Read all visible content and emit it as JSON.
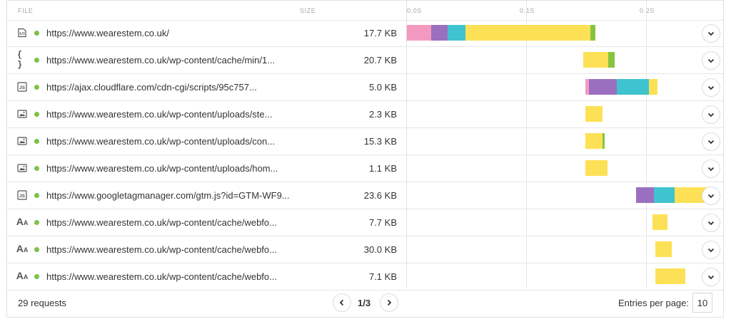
{
  "header": {
    "file_label": "FILE",
    "size_label": "SIZE",
    "ticks": [
      "0.0s",
      "0.1s",
      "0.2s"
    ]
  },
  "colors": {
    "blocking": "#f49ac1",
    "dns": "#9b6fc0",
    "connect": "#3fc3cf",
    "wait": "#fce156",
    "receive": "#86c440",
    "status_dot": "#7cc246"
  },
  "rows": [
    {
      "icon": "html-file-icon",
      "url": "https://www.wearestem.co.uk/",
      "size": "17.7 KB",
      "timing": {
        "start": 0.0,
        "segments": [
          [
            "blocking",
            0.02
          ],
          [
            "dns",
            0.014
          ],
          [
            "connect",
            0.015
          ],
          [
            "wait",
            0.104
          ],
          [
            "receive",
            0.004
          ]
        ]
      }
    },
    {
      "icon": "css-file-icon",
      "url": "https://www.wearestem.co.uk/wp-content/cache/min/1...",
      "size": "20.7 KB",
      "timing": {
        "start": 0.147,
        "segments": [
          [
            "wait",
            0.021
          ],
          [
            "receive",
            0.005
          ]
        ]
      }
    },
    {
      "icon": "js-file-icon",
      "url": "https://ajax.cloudflare.com/cdn-cgi/scripts/95c757...",
      "size": "5.0 KB",
      "timing": {
        "start": 0.149,
        "segments": [
          [
            "blocking",
            0.003
          ],
          [
            "dns",
            0.023
          ],
          [
            "connect",
            0.027
          ],
          [
            "wait",
            0.007
          ]
        ]
      }
    },
    {
      "icon": "image-file-icon",
      "url": "https://www.wearestem.co.uk/wp-content/uploads/ste...",
      "size": "2.3 KB",
      "timing": {
        "start": 0.149,
        "segments": [
          [
            "wait",
            0.014
          ]
        ]
      }
    },
    {
      "icon": "image-file-icon",
      "url": "https://www.wearestem.co.uk/wp-content/uploads/con...",
      "size": "15.3 KB",
      "timing": {
        "start": 0.149,
        "segments": [
          [
            "wait",
            0.014
          ],
          [
            "receive",
            0.002
          ]
        ]
      }
    },
    {
      "icon": "image-file-icon",
      "url": "https://www.wearestem.co.uk/wp-content/uploads/hom...",
      "size": "1.1 KB",
      "timing": {
        "start": 0.149,
        "segments": [
          [
            "wait",
            0.018
          ]
        ]
      }
    },
    {
      "icon": "js-file-icon",
      "url": "https://www.googletagmanager.com/gtm.js?id=GTM-WF9...",
      "size": "23.6 KB",
      "timing": {
        "start": 0.191,
        "segments": [
          [
            "dns",
            0.015
          ],
          [
            "connect",
            0.017
          ],
          [
            "wait",
            0.028
          ]
        ]
      }
    },
    {
      "icon": "font-file-icon",
      "url": "https://www.wearestem.co.uk/wp-content/cache/webfo...",
      "size": "7.7 KB",
      "timing": {
        "start": 0.205,
        "segments": [
          [
            "wait",
            0.012
          ]
        ]
      }
    },
    {
      "icon": "font-file-icon",
      "url": "https://www.wearestem.co.uk/wp-content/cache/webfo...",
      "size": "30.0 KB",
      "timing": {
        "start": 0.207,
        "segments": [
          [
            "wait",
            0.014
          ]
        ]
      }
    },
    {
      "icon": "font-file-icon",
      "url": "https://www.wearestem.co.uk/wp-content/cache/webfo...",
      "size": "7.1 KB",
      "timing": {
        "start": 0.207,
        "segments": [
          [
            "wait",
            0.025
          ]
        ]
      }
    }
  ],
  "footer": {
    "requests": "29 requests",
    "page": "1/3",
    "entries_label": "Entries per page:",
    "entries_value": "10"
  }
}
